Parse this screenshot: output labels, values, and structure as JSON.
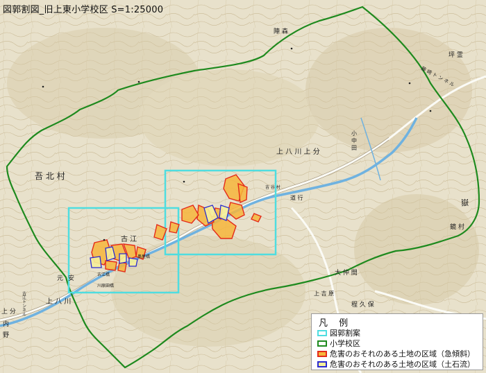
{
  "title": "図郭割図_旧上東小学校区  S=1:25000",
  "colors": {
    "cyan": "#4fdde0",
    "green": "#1e8a1e",
    "red": "#e42a1a",
    "orange_fill": "#f6b53c",
    "blue": "#2a2ad0",
    "yellow_fill": "#f5ef9a",
    "river": "#6fb2e0",
    "background": "#e9e3cf"
  },
  "place_labels": {
    "gohoku": "吾 北 村",
    "kami_yakawa_kamibun": "上 八 川 上 分",
    "kami_yakawa": "上 八 川",
    "koe": "古 江",
    "moto": "元",
    "an": "安",
    "kamibun": "上 分",
    "uchi": "内",
    "no": "野",
    "dake": "嶽",
    "oshiro": "大 仲 間",
    "kamiyoshihara": "上 吉 原",
    "kubo": "程 久 保",
    "takamori": "陣 森",
    "konaka": "小 中 田",
    "tsuji": "道 行",
    "furue_bridge": "古江橋",
    "kawaharada_bridge": "川原田橋",
    "kawanaka_bridge": "奥屋橋",
    "koe_tunnel": "古江トンネル",
    "minehara": "坪 霊",
    "minetunnel": "藤 崎 ト ン ネ ル",
    "hiro": "鏡 村",
    "ishidaki": "吉 谷 村"
  },
  "legend": {
    "title": "凡 例",
    "items": [
      {
        "label": "図郭割案",
        "swatch": "cyan-outline"
      },
      {
        "label": "小学校区",
        "swatch": "green-outline"
      },
      {
        "label": "危害のおそれのある土地の区域（急傾斜）",
        "swatch": "red-orange"
      },
      {
        "label": "危害のおそれのある土地の区域（土石流）",
        "swatch": "blue-yellow"
      }
    ]
  }
}
